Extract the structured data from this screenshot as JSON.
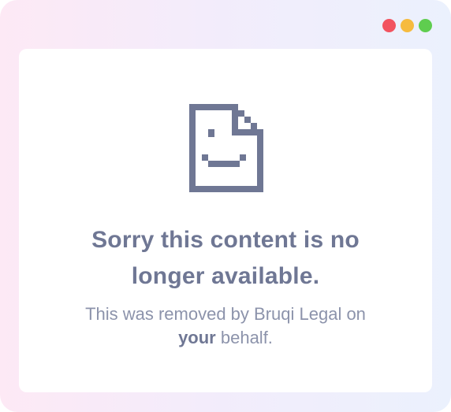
{
  "window": {
    "controls": [
      "close",
      "minimize",
      "maximize"
    ],
    "colors": {
      "close": "#f2535f",
      "minimize": "#f6bb3f",
      "maximize": "#5fcd4f"
    }
  },
  "message": {
    "icon": "sad-document-icon",
    "title_line1": "Sorry this content is no",
    "title_line2": "longer available.",
    "body_line1": "This was removed by Bruqi Legal on",
    "body_emphasis": "your",
    "body_rest": " behalf."
  },
  "colors": {
    "title": "#6f7794",
    "body": "#8c93ab",
    "icon": "#6f7794"
  }
}
